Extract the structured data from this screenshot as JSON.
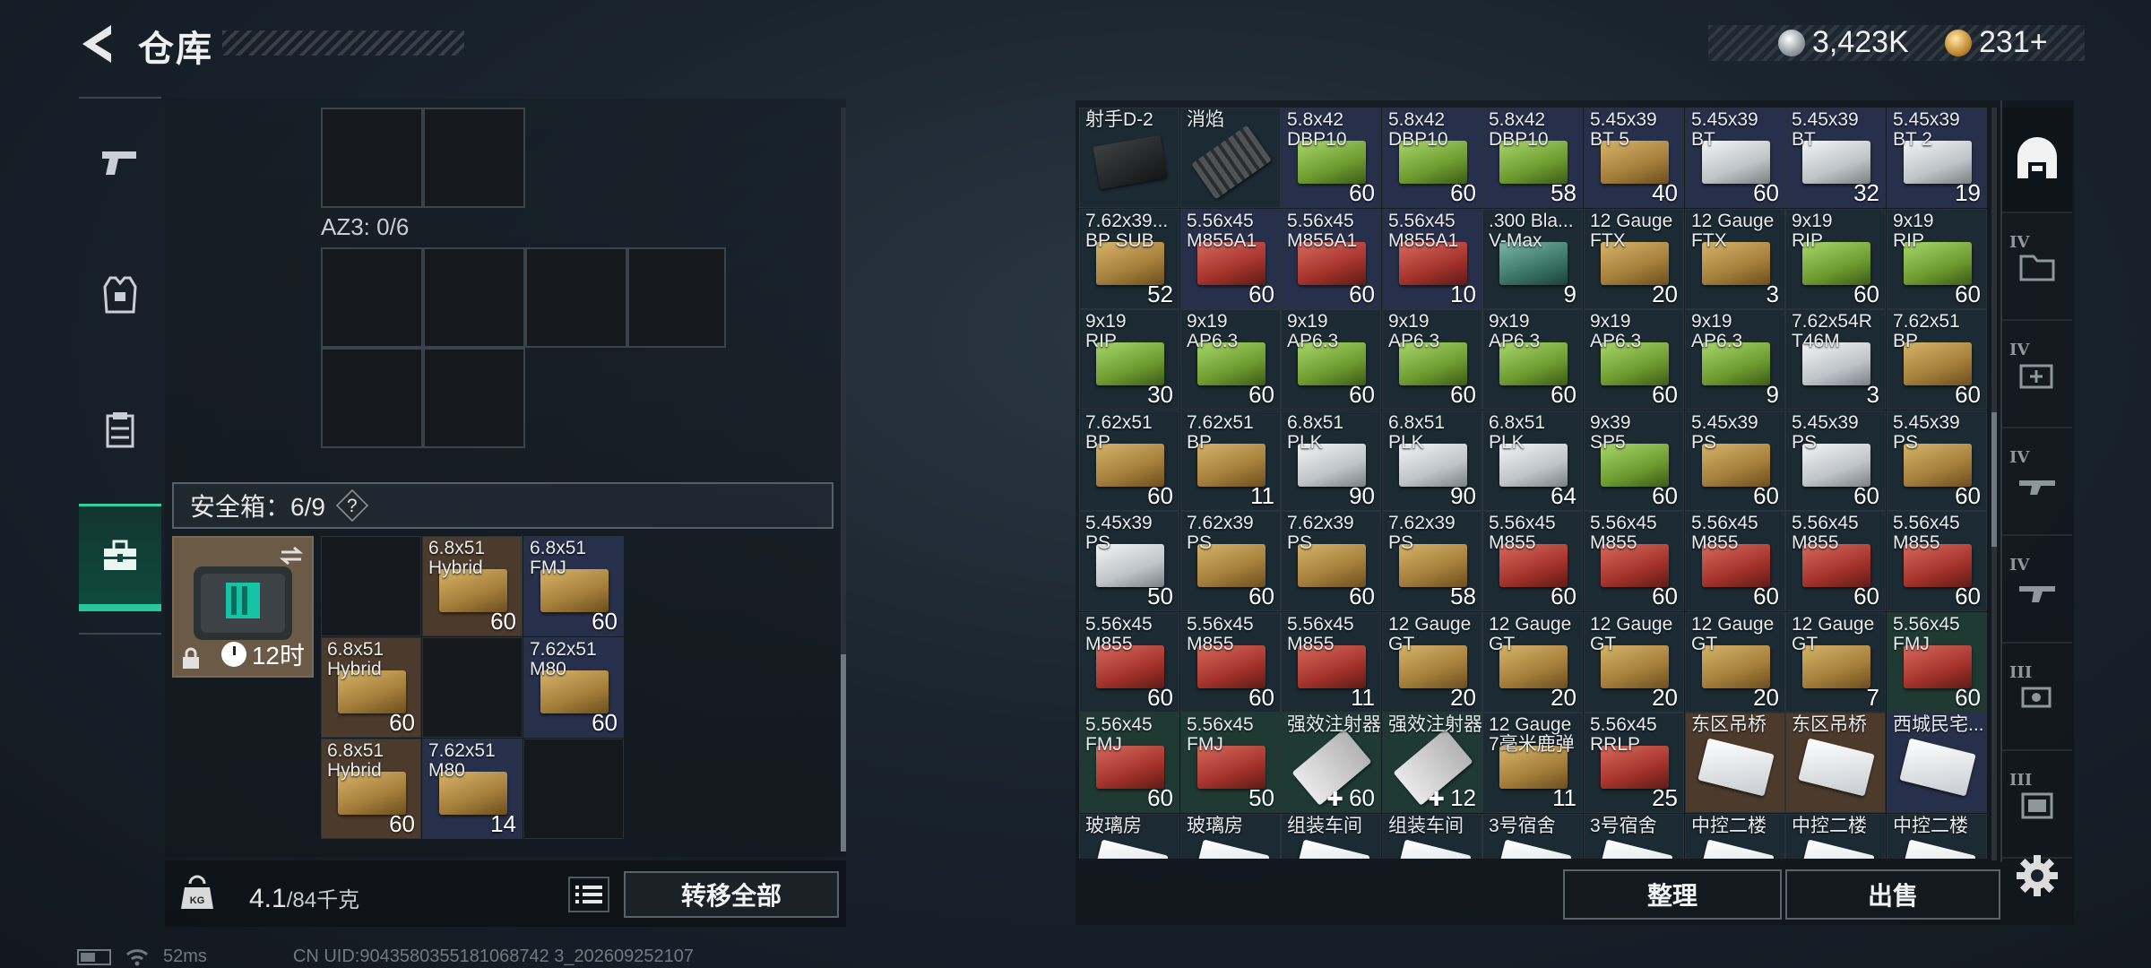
{
  "header": {
    "title": "仓库",
    "currency_silver": "3,423K",
    "currency_gold": "231+"
  },
  "left": {
    "az3_label": "AZ3: 0/6",
    "safe_box_label": "安全箱：6/9",
    "safe_box_help": "?",
    "safe_box_timer": "12时",
    "safe_items": [
      {
        "name": "6.8x51\nHybrid",
        "count": "60",
        "bg": "brown",
        "art": "gold"
      },
      {
        "name": "6.8x51\nFMJ",
        "count": "60",
        "bg": "blue",
        "art": "gold"
      },
      {
        "name": "6.8x51\nHybrid",
        "count": "60",
        "bg": "brown",
        "art": "gold"
      },
      {
        "name": "7.62x51\nM80",
        "count": "60",
        "bg": "blue",
        "art": "gold"
      },
      {
        "name": "6.8x51\nHybrid",
        "count": "60",
        "bg": "brown",
        "art": "gold"
      },
      {
        "name": "7.62x51\nM80",
        "count": "14",
        "bg": "blue",
        "art": "gold"
      }
    ],
    "weight_value": "4.1",
    "weight_max": "/84千克",
    "transfer_all": "转移全部"
  },
  "status": {
    "ping": "52ms",
    "uid": "CN UID:9043580355181068742 3_202609252107"
  },
  "right": {
    "sort_label": "整理",
    "sell_label": "出售",
    "rail_tiers": [
      "IV",
      "IV",
      "IV",
      "IV",
      "III",
      "III"
    ],
    "rows": [
      [
        {
          "name": "射手D-2",
          "count": "",
          "bg": "gray",
          "art": "grip"
        },
        {
          "name": "消焰",
          "count": "",
          "bg": "gray",
          "art": "muzzle"
        },
        {
          "name": "5.8x42\nDBP10",
          "count": "60",
          "bg": "blue",
          "art": "green"
        },
        {
          "name": "5.8x42\nDBP10",
          "count": "60",
          "bg": "blue",
          "art": "green"
        },
        {
          "name": "5.8x42\nDBP10",
          "count": "58",
          "bg": "blue",
          "art": "green"
        },
        {
          "name": "5.45x39\nBT 5",
          "count": "40",
          "bg": "blue",
          "art": "gold"
        },
        {
          "name": "5.45x39\nBT",
          "count": "60",
          "bg": "blue",
          "art": "silver"
        },
        {
          "name": "5.45x39\nBT",
          "count": "32",
          "bg": "blue",
          "art": "silver"
        },
        {
          "name": "5.45x39\nBT 2",
          "count": "19",
          "bg": "blue",
          "art": "silver"
        }
      ],
      [
        {
          "name": "7.62x39...\nBP SUB",
          "count": "52",
          "bg": "gray",
          "art": "gold"
        },
        {
          "name": "5.56x45\nM855A1",
          "count": "60",
          "bg": "blue",
          "art": "red"
        },
        {
          "name": "5.56x45\nM855A1",
          "count": "60",
          "bg": "blue",
          "art": "red"
        },
        {
          "name": "5.56x45\nM855A1",
          "count": "10",
          "bg": "blue",
          "art": "red"
        },
        {
          "name": ".300 Bla...\nV-Max",
          "count": "9",
          "bg": "gray",
          "art": "teal"
        },
        {
          "name": "12 Gauge\nFTX",
          "count": "20",
          "bg": "gray",
          "art": "gold"
        },
        {
          "name": "12 Gauge\nFTX",
          "count": "3",
          "bg": "gray",
          "art": "gold"
        },
        {
          "name": "9x19\nRIP",
          "count": "60",
          "bg": "gray",
          "art": "green"
        },
        {
          "name": "9x19\nRIP",
          "count": "60",
          "bg": "gray",
          "art": "green"
        }
      ],
      [
        {
          "name": "9x19\nRIP",
          "count": "30",
          "bg": "gray",
          "art": "green"
        },
        {
          "name": "9x19\nAP6.3",
          "count": "60",
          "bg": "gray",
          "art": "green"
        },
        {
          "name": "9x19\nAP6.3",
          "count": "60",
          "bg": "gray",
          "art": "green"
        },
        {
          "name": "9x19\nAP6.3",
          "count": "60",
          "bg": "gray",
          "art": "green"
        },
        {
          "name": "9x19\nAP6.3",
          "count": "60",
          "bg": "gray",
          "art": "green"
        },
        {
          "name": "9x19\nAP6.3",
          "count": "60",
          "bg": "gray",
          "art": "green"
        },
        {
          "name": "9x19\nAP6.3",
          "count": "9",
          "bg": "gray",
          "art": "green"
        },
        {
          "name": "7.62x54R\nT46M",
          "count": "3",
          "bg": "gray",
          "art": "silver"
        },
        {
          "name": "7.62x51\nBP",
          "count": "60",
          "bg": "gray",
          "art": "gold"
        }
      ],
      [
        {
          "name": "7.62x51\nBP",
          "count": "60",
          "bg": "gray",
          "art": "gold"
        },
        {
          "name": "7.62x51\nBP",
          "count": "11",
          "bg": "gray",
          "art": "gold"
        },
        {
          "name": "6.8x51\nPLK",
          "count": "90",
          "bg": "gray",
          "art": "silver"
        },
        {
          "name": "6.8x51\nPLK",
          "count": "90",
          "bg": "gray",
          "art": "silver"
        },
        {
          "name": "6.8x51\nPLK",
          "count": "64",
          "bg": "gray",
          "art": "silver"
        },
        {
          "name": "9x39\nSP5",
          "count": "60",
          "bg": "gray",
          "art": "green"
        },
        {
          "name": "5.45x39\nPS",
          "count": "60",
          "bg": "gray",
          "art": "gold"
        },
        {
          "name": "5.45x39\nPS",
          "count": "60",
          "bg": "gray",
          "art": "silver"
        },
        {
          "name": "5.45x39\nPS",
          "count": "60",
          "bg": "gray",
          "art": "gold"
        }
      ],
      [
        {
          "name": "5.45x39\nPS",
          "count": "50",
          "bg": "gray",
          "art": "silver"
        },
        {
          "name": "7.62x39\nPS",
          "count": "60",
          "bg": "gray",
          "art": "gold"
        },
        {
          "name": "7.62x39\nPS",
          "count": "60",
          "bg": "gray",
          "art": "gold"
        },
        {
          "name": "7.62x39\nPS",
          "count": "58",
          "bg": "gray",
          "art": "gold"
        },
        {
          "name": "5.56x45\nM855",
          "count": "60",
          "bg": "gray",
          "art": "red"
        },
        {
          "name": "5.56x45\nM855",
          "count": "60",
          "bg": "gray",
          "art": "red"
        },
        {
          "name": "5.56x45\nM855",
          "count": "60",
          "bg": "gray",
          "art": "red"
        },
        {
          "name": "5.56x45\nM855",
          "count": "60",
          "bg": "gray",
          "art": "red"
        },
        {
          "name": "5.56x45\nM855",
          "count": "60",
          "bg": "gray",
          "art": "red"
        }
      ],
      [
        {
          "name": "5.56x45\nM855",
          "count": "60",
          "bg": "gray",
          "art": "red"
        },
        {
          "name": "5.56x45\nM855",
          "count": "60",
          "bg": "gray",
          "art": "red"
        },
        {
          "name": "5.56x45\nM855",
          "count": "11",
          "bg": "gray",
          "art": "red"
        },
        {
          "name": "12 Gauge\nGT",
          "count": "20",
          "bg": "gray",
          "art": "gold"
        },
        {
          "name": "12 Gauge\nGT",
          "count": "20",
          "bg": "gray",
          "art": "gold"
        },
        {
          "name": "12 Gauge\nGT",
          "count": "20",
          "bg": "gray",
          "art": "gold"
        },
        {
          "name": "12 Gauge\nGT",
          "count": "20",
          "bg": "gray",
          "art": "gold"
        },
        {
          "name": "12 Gauge\nGT",
          "count": "7",
          "bg": "gray",
          "art": "gold"
        },
        {
          "name": "5.56x45\nFMJ",
          "count": "60",
          "bg": "green",
          "art": "red"
        }
      ],
      [
        {
          "name": "5.56x45\nFMJ",
          "count": "60",
          "bg": "green",
          "art": "red"
        },
        {
          "name": "5.56x45\nFMJ",
          "count": "50",
          "bg": "green",
          "art": "red"
        },
        {
          "name": "强效注射器",
          "count": "60",
          "bg": "green",
          "art": "syringe",
          "badge": true
        },
        {
          "name": "强效注射器",
          "count": "12",
          "bg": "green",
          "art": "syringe",
          "badge": true
        },
        {
          "name": "12 Gauge\n7毫米鹿弹",
          "count": "11",
          "bg": "gray",
          "art": "gold"
        },
        {
          "name": "5.56x45\nRRLP",
          "count": "25",
          "bg": "gray",
          "art": "red"
        },
        {
          "name": "东区吊桥",
          "count": "",
          "bg": "brown",
          "art": "key"
        },
        {
          "name": "东区吊桥",
          "count": "",
          "bg": "brown",
          "art": "key"
        },
        {
          "name": "西城民宅...",
          "count": "",
          "bg": "blue",
          "art": "key"
        }
      ],
      [
        {
          "name": "玻璃房",
          "count": "",
          "bg": "gray",
          "art": "key"
        },
        {
          "name": "玻璃房",
          "count": "",
          "bg": "gray",
          "art": "key"
        },
        {
          "name": "组装车间",
          "count": "",
          "bg": "gray",
          "art": "key"
        },
        {
          "name": "组装车间",
          "count": "",
          "bg": "gray",
          "art": "key"
        },
        {
          "name": "3号宿舍",
          "count": "",
          "bg": "gray",
          "art": "key"
        },
        {
          "name": "3号宿舍",
          "count": "",
          "bg": "gray",
          "art": "key"
        },
        {
          "name": "中控二楼",
          "count": "",
          "bg": "gray",
          "art": "key"
        },
        {
          "name": "中控二楼",
          "count": "",
          "bg": "gray",
          "art": "key"
        },
        {
          "name": "中控二楼",
          "count": "",
          "bg": "gray",
          "art": "key"
        }
      ]
    ]
  }
}
